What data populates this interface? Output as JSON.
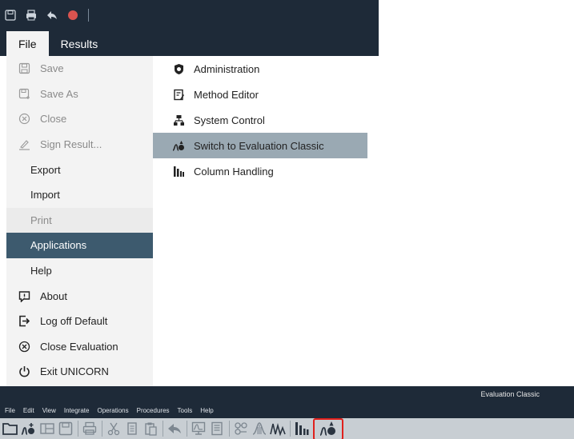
{
  "top_tabs": [
    {
      "label": "File"
    },
    {
      "label": "Results"
    }
  ],
  "file_menu": {
    "items": [
      {
        "label": "Save",
        "icon": "save-icon",
        "state": "disabled"
      },
      {
        "label": "Save As",
        "icon": "save-as-icon",
        "state": "disabled"
      },
      {
        "label": "Close",
        "icon": "close-circle-icon",
        "state": "disabled"
      },
      {
        "label": "Sign Result...",
        "icon": "sign-icon",
        "state": "disabled"
      },
      {
        "label": "Export",
        "icon": "",
        "state": "enabled"
      },
      {
        "label": "Import",
        "icon": "",
        "state": "enabled"
      },
      {
        "label": "Print",
        "icon": "",
        "state": "disabled"
      },
      {
        "label": "Applications",
        "icon": "",
        "state": "selected"
      },
      {
        "label": "Help",
        "icon": "",
        "state": "enabled"
      },
      {
        "label": "About",
        "icon": "about-icon",
        "state": "enabled"
      },
      {
        "label": "Log off Default",
        "icon": "log-off-icon",
        "state": "enabled"
      },
      {
        "label": "Close Evaluation",
        "icon": "close-circle-icon",
        "state": "enabled"
      },
      {
        "label": "Exit UNICORN",
        "icon": "power-icon",
        "state": "enabled"
      }
    ]
  },
  "applications_submenu": {
    "items": [
      {
        "label": "Administration",
        "icon": "administration-shield-icon"
      },
      {
        "label": "Method Editor",
        "icon": "method-editor-icon"
      },
      {
        "label": "System Control",
        "icon": "system-control-icon"
      },
      {
        "label": "Switch to Evaluation Classic",
        "icon": "evaluation-classic-icon",
        "highlighted": true
      },
      {
        "label": "Column Handling",
        "icon": "column-handling-icon"
      }
    ]
  },
  "evaluation_classic": {
    "title": "Evaluation Classic",
    "menu": [
      "File",
      "Edit",
      "View",
      "Integrate",
      "Operations",
      "Procedures",
      "Tools",
      "Help"
    ]
  },
  "colors": {
    "chrome": "#1e2a38",
    "menu_bg": "#f3f3f3",
    "selected": "#3d5a6e",
    "highlight": "#9aa9b3",
    "highlight_border": "#e0201c"
  }
}
